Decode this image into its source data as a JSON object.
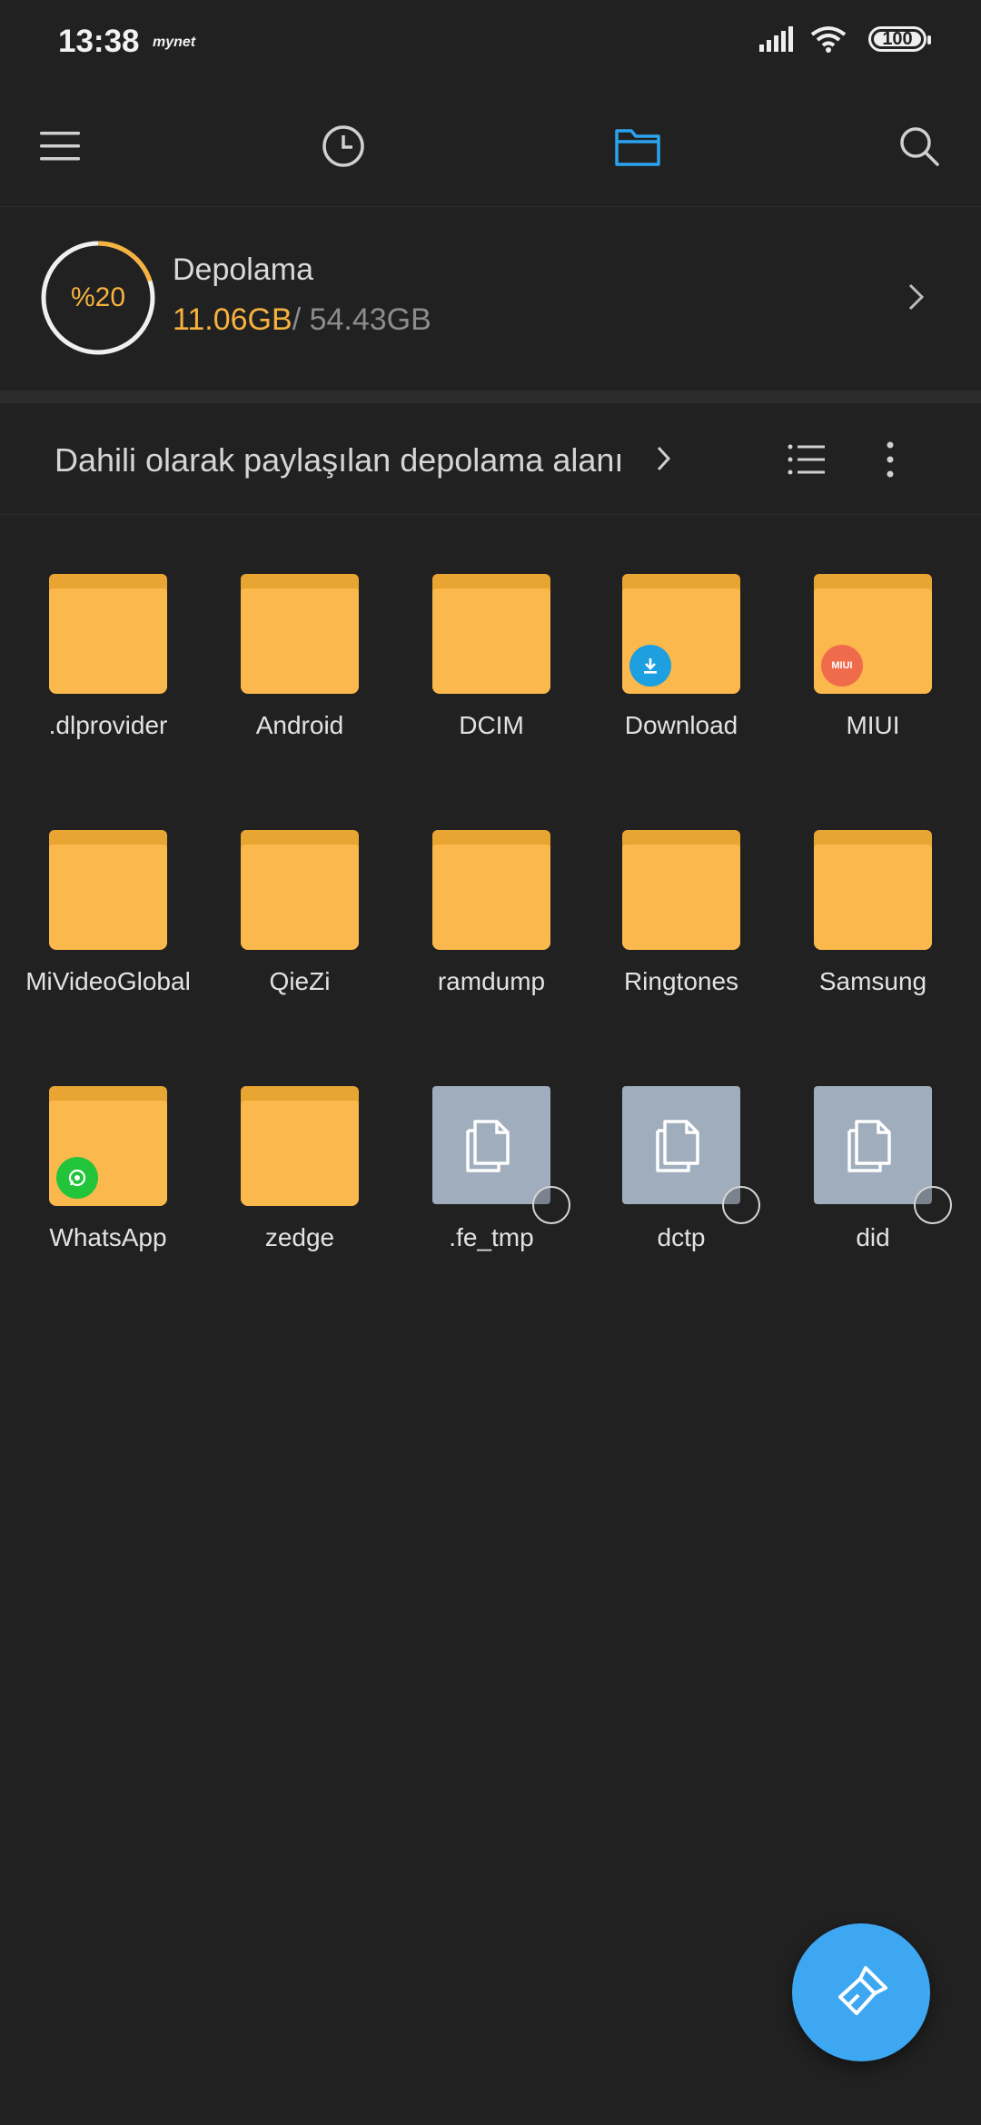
{
  "status_bar": {
    "time": "13:38",
    "brand": "mynet",
    "battery": "100"
  },
  "toolbar": {
    "menu_icon": "menu-icon",
    "recent_icon": "clock-icon",
    "folder_icon": "folder-icon",
    "search_icon": "search-icon",
    "active_color": "#2aa3f0"
  },
  "storage": {
    "percent": "%20",
    "used_fraction": 0.2,
    "title": "Depolama",
    "used": "11.06GB",
    "total": "/ 54.43GB"
  },
  "path": {
    "label": "Dahili olarak paylaşılan depolama alanı"
  },
  "items": [
    {
      "name": ".dlprovider",
      "type": "folder"
    },
    {
      "name": "Android",
      "type": "folder"
    },
    {
      "name": "DCIM",
      "type": "folder"
    },
    {
      "name": "Download",
      "type": "folder",
      "badge": "download"
    },
    {
      "name": "MIUI",
      "type": "folder",
      "badge": "MIUI"
    },
    {
      "name": "MiVideoGlobal",
      "type": "folder"
    },
    {
      "name": "QieZi",
      "type": "folder"
    },
    {
      "name": "ramdump",
      "type": "folder"
    },
    {
      "name": "Ringtones",
      "type": "folder"
    },
    {
      "name": "Samsung",
      "type": "folder"
    },
    {
      "name": "WhatsApp",
      "type": "folder",
      "badge": "whatsapp"
    },
    {
      "name": "zedge",
      "type": "folder"
    },
    {
      "name": ".fe_tmp",
      "type": "file"
    },
    {
      "name": "dctp",
      "type": "file"
    },
    {
      "name": "did",
      "type": "file"
    }
  ],
  "fab": {
    "icon": "clean-brush-icon",
    "color": "#3ea7f2"
  }
}
